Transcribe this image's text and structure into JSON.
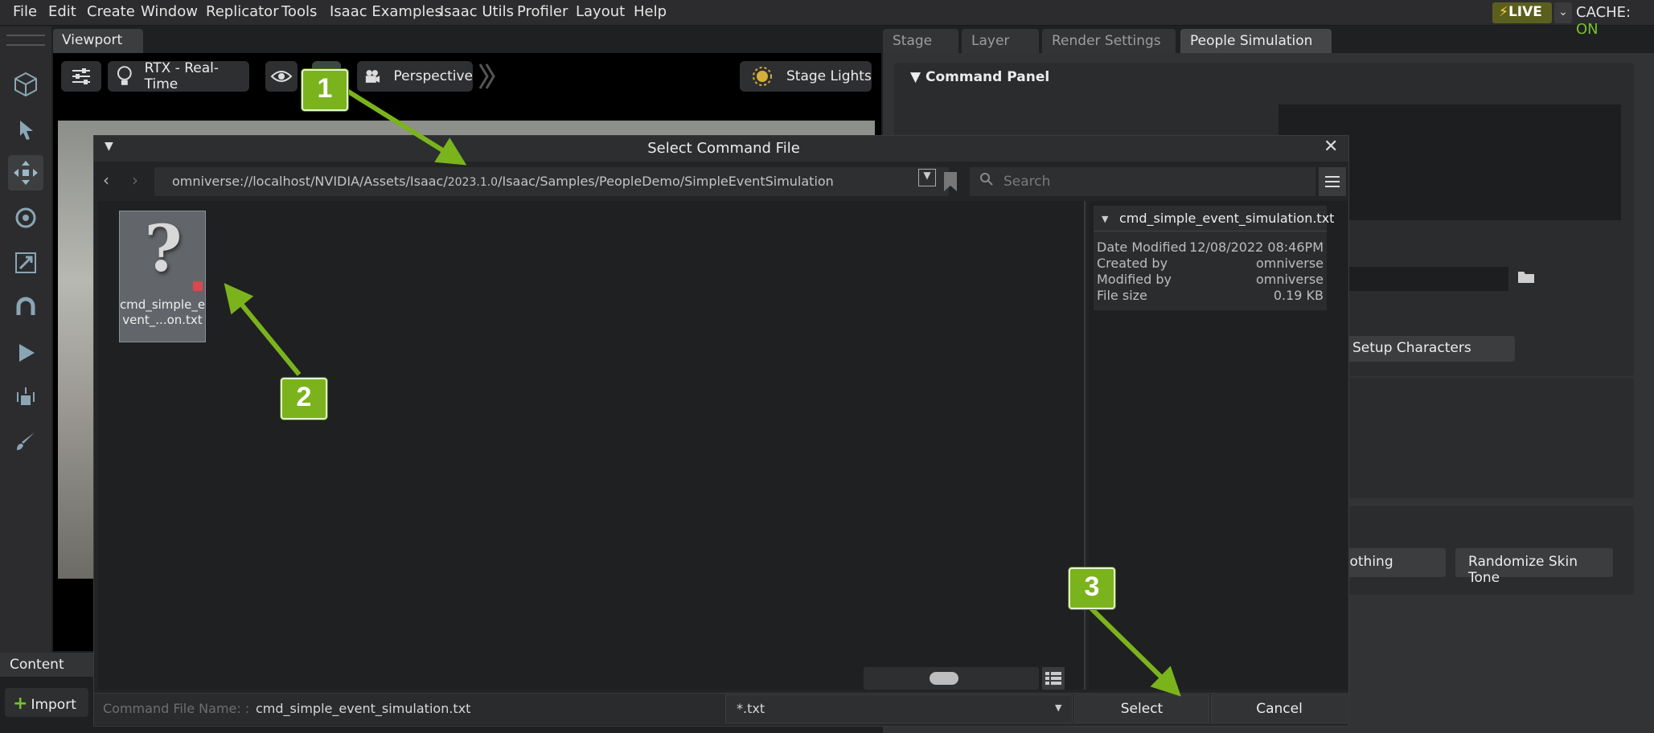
{
  "menubar": {
    "items": [
      "File",
      "Edit",
      "Create",
      "Window",
      "Replicator",
      "Tools",
      "Isaac Examples",
      "Isaac Utils",
      "Profiler",
      "Layout",
      "Help"
    ],
    "live": "LIVE",
    "cache_label": "CACHE:",
    "cache_status": "ON"
  },
  "viewport": {
    "tab": "Viewport",
    "renderer": "RTX - Real-Time",
    "camera": "Perspective",
    "lights": "Stage Lights"
  },
  "right_tabs": [
    "Stage",
    "Layer",
    "Render Settings",
    "People Simulation"
  ],
  "right_panel": {
    "command_panel_title": "Command Panel",
    "setup_characters": "Setup Characters",
    "randomize_clothing": "Randomize Clothing",
    "randomize_skin_tone": "Randomize Skin Tone"
  },
  "content": {
    "tab": "Content",
    "import": "Import"
  },
  "dialog": {
    "title": "Select Command File",
    "path_prefix": "omniverse://localhost/NVIDIA/Assets/Isaac/",
    "path_version": "2023.1.0",
    "path_suffix": "/Isaac/Samples/PeopleDemo/SimpleEventSimulation",
    "search_placeholder": "Search",
    "file": {
      "label_line1": "cmd_simple_e",
      "label_line2": "vent_...on.txt"
    },
    "info": {
      "filename": "cmd_simple_event_simulation.txt",
      "rows": [
        {
          "label": "Date Modified",
          "value": "12/08/2022 08:46PM"
        },
        {
          "label": "Created by",
          "value": "omniverse"
        },
        {
          "label": "Modified by",
          "value": "omniverse"
        },
        {
          "label": "File size",
          "value": "0.19 KB"
        }
      ]
    },
    "filename_label": "Command File Name: :",
    "filename_value": "cmd_simple_event_simulation.txt",
    "filter": "*.txt",
    "select": "Select",
    "cancel": "Cancel"
  },
  "callouts": [
    "1",
    "2",
    "3"
  ],
  "colors": {
    "accent_green": "#7bb31d",
    "cache_on": "#76c22c"
  }
}
